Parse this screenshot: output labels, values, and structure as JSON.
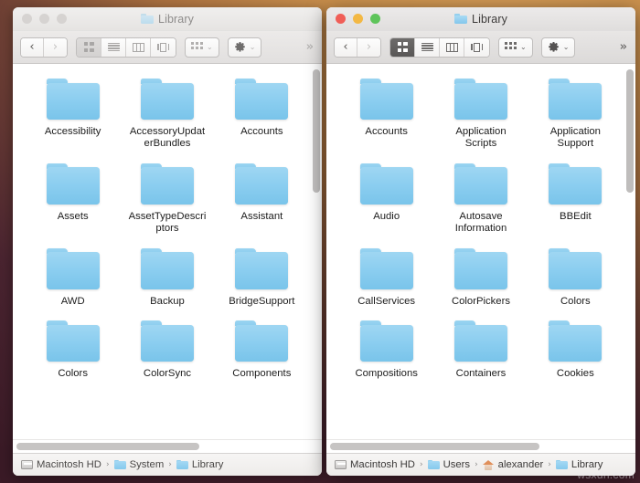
{
  "desktop": {
    "watermark": "wsxdn.com",
    "background_colors": [
      "#d9a05a",
      "#a86f3f",
      "#4a2430",
      "#331520"
    ]
  },
  "windows": [
    {
      "id": "left",
      "active": false,
      "title": "Library",
      "title_icon": "folder-icon",
      "traffic_lights": [
        {
          "name": "close-button",
          "color": "#d6d3d1"
        },
        {
          "name": "minimize-button",
          "color": "#d6d3d1"
        },
        {
          "name": "maximize-button",
          "color": "#d6d3d1"
        }
      ],
      "toolbar": {
        "back_label": "‹",
        "forward_label": "›",
        "view_modes": [
          {
            "name": "icon-view",
            "icon": "grid-icon",
            "selected": true
          },
          {
            "name": "list-view",
            "icon": "list-icon",
            "selected": false
          },
          {
            "name": "column-view",
            "icon": "columns-icon",
            "selected": false
          },
          {
            "name": "gallery-view",
            "icon": "coverflow-icon",
            "selected": false
          }
        ],
        "group_by": {
          "name": "group-by-button",
          "icon": "group-icon",
          "chevron": "⌄"
        },
        "action": {
          "name": "action-button",
          "icon": "gear-icon",
          "chevron": "⌄"
        },
        "overflow_label": "»"
      },
      "folders": [
        "Accessibility",
        "AccessoryUpdaterBundles",
        "Accounts",
        "Assets",
        "AssetTypeDescriptors",
        "Assistant",
        "AWD",
        "Backup",
        "BridgeSupport",
        "Colors",
        "ColorSync",
        "Components"
      ],
      "path": [
        {
          "label": "Macintosh HD",
          "icon": "hard-disk-icon"
        },
        {
          "label": "System",
          "icon": "folder-icon"
        },
        {
          "label": "Library",
          "icon": "folder-icon"
        }
      ],
      "path_separator": "›"
    },
    {
      "id": "right",
      "active": true,
      "title": "Library",
      "title_icon": "folder-icon",
      "traffic_lights": [
        {
          "name": "close-button",
          "color": "#f05e57"
        },
        {
          "name": "minimize-button",
          "color": "#f3b844"
        },
        {
          "name": "maximize-button",
          "color": "#5ec45a"
        }
      ],
      "toolbar": {
        "back_label": "‹",
        "forward_label": "›",
        "view_modes": [
          {
            "name": "icon-view",
            "icon": "grid-icon",
            "selected": true
          },
          {
            "name": "list-view",
            "icon": "list-icon",
            "selected": false
          },
          {
            "name": "column-view",
            "icon": "columns-icon",
            "selected": false
          },
          {
            "name": "gallery-view",
            "icon": "coverflow-icon",
            "selected": false
          }
        ],
        "group_by": {
          "name": "group-by-button",
          "icon": "group-icon",
          "chevron": "⌄"
        },
        "action": {
          "name": "action-button",
          "icon": "gear-icon",
          "chevron": "⌄"
        },
        "overflow_label": "»"
      },
      "folders": [
        "Accounts",
        "Application Scripts",
        "Application Support",
        "Audio",
        "Autosave Information",
        "BBEdit",
        "CallServices",
        "ColorPickers",
        "Colors",
        "Compositions",
        "Containers",
        "Cookies"
      ],
      "path": [
        {
          "label": "Macintosh HD",
          "icon": "hard-disk-icon"
        },
        {
          "label": "Users",
          "icon": "folder-icon"
        },
        {
          "label": "alexander",
          "icon": "home-icon"
        },
        {
          "label": "Library",
          "icon": "folder-icon"
        }
      ],
      "path_separator": "›"
    }
  ]
}
